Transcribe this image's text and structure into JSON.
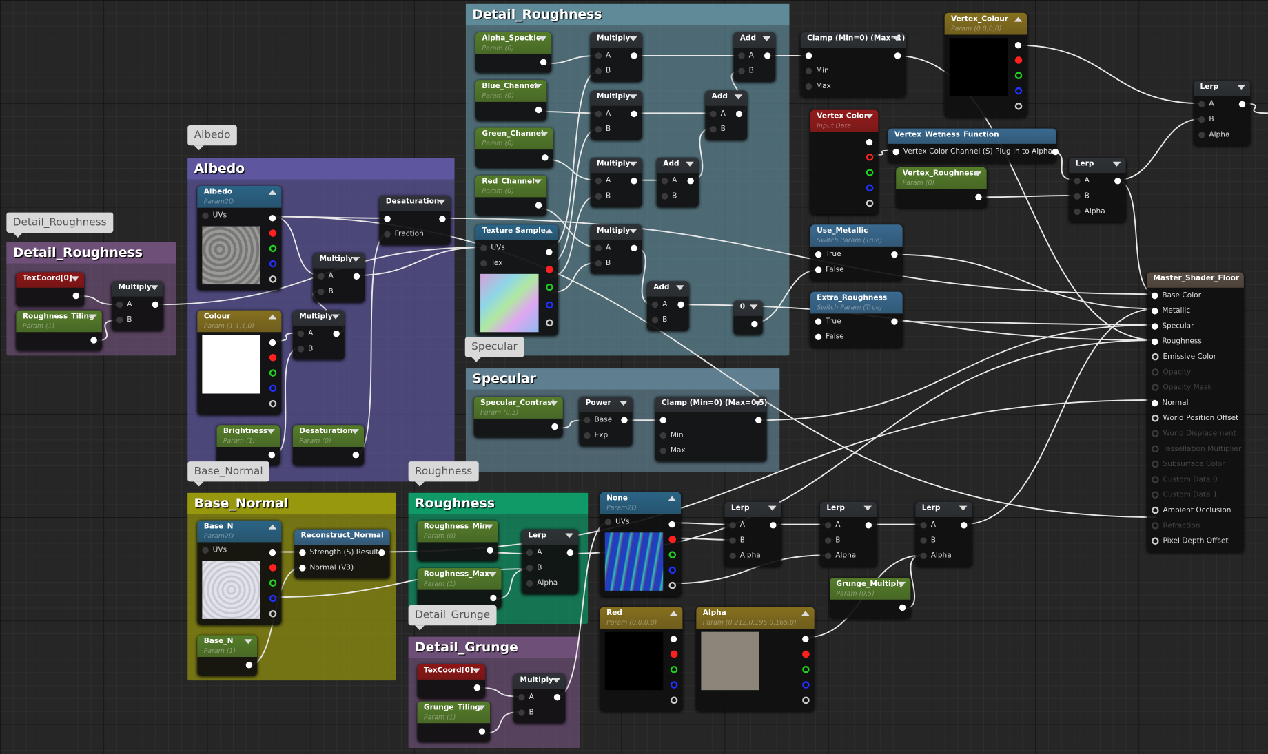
{
  "comments": [
    {
      "id": "c_detail_small",
      "title": "Detail_Roughness",
      "bubble": "Detail_Roughness",
      "color": "#6e4f77"
    },
    {
      "id": "c_albedo",
      "title": "Albedo",
      "bubble": "Albedo",
      "color": "#5e57a0"
    },
    {
      "id": "c_detail_big",
      "title": "Detail_Roughness",
      "bubble": "",
      "color": "#5f8a98"
    },
    {
      "id": "c_specular",
      "title": "Specular",
      "bubble": "Specular",
      "color": "#5f7f90"
    },
    {
      "id": "c_base_normal",
      "title": "Base_Normal",
      "bubble": "Base_Normal",
      "color": "#98980f"
    },
    {
      "id": "c_roughness",
      "title": "Roughness",
      "bubble": "Roughness",
      "color": "#0f9a68"
    },
    {
      "id": "c_detail_grunge",
      "title": "Detail_Grunge",
      "bubble": "Detail_Grunge",
      "color": "#6e4f77"
    }
  ],
  "header_colors": {
    "param": "#557d2a",
    "tex": "#2b6486",
    "vec": "#86701f",
    "coord": "#8e1616",
    "func": "#3a6a90",
    "math": "#2f3337",
    "master": "#5b4f45",
    "input": "#951b1b"
  },
  "nodes": [
    {
      "id": "texcoord1",
      "type": "coord",
      "title": "TexCoord[0]",
      "outputs": [
        ""
      ]
    },
    {
      "id": "rtiling",
      "type": "param",
      "title": "Roughness_Tiling",
      "sub": "Param (1)",
      "outputs": [
        ""
      ]
    },
    {
      "id": "mul_a",
      "type": "math",
      "title": "Multiply",
      "inputs": [
        "A",
        "B"
      ],
      "outputs": [
        ""
      ]
    },
    {
      "id": "albedo",
      "type": "tex",
      "title": "Albedo",
      "sub": "Param2D",
      "inputs": [
        "UVs"
      ],
      "preview": "#8a8a86",
      "up": true
    },
    {
      "id": "colour",
      "type": "vec",
      "title": "Colour",
      "sub": "Param (1,1,1,0)",
      "inputs": [],
      "preview": "#ffffff",
      "up": true
    },
    {
      "id": "mul_b",
      "type": "math",
      "title": "Multiply",
      "inputs": [
        "A",
        "B"
      ],
      "outputs": [
        ""
      ]
    },
    {
      "id": "mul_c",
      "type": "math",
      "title": "Multiply",
      "inputs": [
        "A",
        "B"
      ],
      "outputs": [
        ""
      ]
    },
    {
      "id": "desat1",
      "type": "math",
      "title": "Desaturation",
      "inputs": [
        "",
        "Fraction"
      ],
      "outputs": [
        ""
      ]
    },
    {
      "id": "brightness",
      "type": "param",
      "title": "Brightness",
      "sub": "Param (1)",
      "outputs": [
        ""
      ]
    },
    {
      "id": "desat_p",
      "type": "param",
      "title": "Desaturation",
      "sub": "Param (0)",
      "outputs": [
        ""
      ]
    },
    {
      "id": "alpha_speckle",
      "type": "param",
      "title": "Alpha_Speckle",
      "sub": "Param (0)",
      "outputs": [
        ""
      ]
    },
    {
      "id": "blue_ch",
      "type": "param",
      "title": "Blue_Channel",
      "sub": "Param (0)",
      "outputs": [
        ""
      ]
    },
    {
      "id": "green_ch",
      "type": "param",
      "title": "Green_Channel",
      "sub": "Param (0)",
      "outputs": [
        ""
      ]
    },
    {
      "id": "red_ch",
      "type": "param",
      "title": "Red_Channel",
      "sub": "Param (0)",
      "outputs": [
        ""
      ]
    },
    {
      "id": "texsample",
      "type": "tex",
      "title": "Texture Sample",
      "inputs": [
        "UVs",
        "Tex"
      ],
      "preview": "#9fb8d8",
      "up": true
    },
    {
      "id": "mul_d1",
      "type": "math",
      "title": "Multiply",
      "inputs": [
        "A",
        "B"
      ],
      "outputs": [
        ""
      ]
    },
    {
      "id": "mul_d2",
      "type": "math",
      "title": "Multiply",
      "inputs": [
        "A",
        "B"
      ],
      "outputs": [
        ""
      ]
    },
    {
      "id": "mul_d3",
      "type": "math",
      "title": "Multiply",
      "inputs": [
        "A",
        "B"
      ],
      "outputs": [
        ""
      ]
    },
    {
      "id": "mul_d4",
      "type": "math",
      "title": "Multiply",
      "inputs": [
        "A",
        "B"
      ],
      "outputs": [
        ""
      ]
    },
    {
      "id": "add1",
      "type": "math",
      "title": "Add",
      "inputs": [
        "A",
        "B"
      ],
      "outputs": [
        ""
      ]
    },
    {
      "id": "add2",
      "type": "math",
      "title": "Add",
      "inputs": [
        "A",
        "B"
      ],
      "outputs": [
        ""
      ]
    },
    {
      "id": "add3",
      "type": "math",
      "title": "Add",
      "inputs": [
        "A",
        "B"
      ],
      "outputs": [
        ""
      ]
    },
    {
      "id": "add4",
      "type": "math",
      "title": "Add",
      "inputs": [
        "A",
        "B"
      ],
      "outputs": [
        ""
      ]
    },
    {
      "id": "const0",
      "type": "math",
      "title": "0",
      "outputs": [
        ""
      ]
    },
    {
      "id": "clamp1",
      "type": "math",
      "title": "Clamp (Min=0) (Max=1)",
      "inputs": [
        "",
        "Min",
        "Max"
      ],
      "outputs": [
        ""
      ]
    },
    {
      "id": "vertex_colour",
      "type": "vec",
      "title": "Vertex_Colour",
      "sub": "Param (0,0,0,0)",
      "inputs": [],
      "preview": "#000000",
      "up": true
    },
    {
      "id": "vertex_color",
      "type": "input",
      "title": "Vertex Color",
      "sub": "Input Data",
      "inputs": [],
      "pinsOnly": true
    },
    {
      "id": "wetness",
      "type": "func",
      "title": "Vertex_Wetness_Function",
      "inputs": [
        "Vertex Color Channel (S)  Plug in to Alpha"
      ],
      "outputs": [
        ""
      ],
      "noarrow": true
    },
    {
      "id": "vertex_rough",
      "type": "param",
      "title": "Vertex_Roughness",
      "sub": "Param (0)",
      "outputs": [
        ""
      ]
    },
    {
      "id": "use_metallic",
      "type": "func",
      "title": "Use_Metallic",
      "sub": "Switch Param (True)",
      "inputs": [
        "True",
        "False"
      ],
      "outputs": [
        ""
      ],
      "noarrow": true
    },
    {
      "id": "extra_rough",
      "type": "func",
      "title": "Extra_Roughness",
      "sub": "Switch Param (True)",
      "inputs": [
        "True",
        "False"
      ],
      "outputs": [
        ""
      ],
      "noarrow": true
    },
    {
      "id": "lerp_top",
      "type": "math",
      "title": "Lerp",
      "inputs": [
        "A",
        "B",
        "Alpha"
      ],
      "outputs": [
        ""
      ]
    },
    {
      "id": "lerp_mid",
      "type": "math",
      "title": "Lerp",
      "inputs": [
        "A",
        "B",
        "Alpha"
      ],
      "outputs": [
        ""
      ]
    },
    {
      "id": "master",
      "type": "master",
      "title": "Master_Shader_Floor",
      "noarrow": true,
      "inputs": [
        "Base Color",
        "Metallic",
        "Specular",
        "Roughness",
        "Emissive Color",
        "Opacity",
        "Opacity Mask",
        "Normal",
        "World Position Offset",
        "World Displacement",
        "Tessellation Multiplier",
        "Subsurface Color",
        "Custom Data 0",
        "Custom Data 1",
        "Ambient Occlusion",
        "Refraction",
        "Pixel Depth Offset"
      ],
      "connected": [
        "Base Color",
        "Metallic",
        "Specular",
        "Roughness",
        "Normal"
      ],
      "disabled": [
        "Opacity",
        "Opacity Mask",
        "World Displacement",
        "Tessellation Multiplier",
        "Subsurface Color",
        "Custom Data 0",
        "Custom Data 1",
        "Refraction"
      ]
    },
    {
      "id": "spec_contrast",
      "type": "param",
      "title": "Specular_Contrast",
      "sub": "Param (0.5)",
      "outputs": [
        ""
      ]
    },
    {
      "id": "power",
      "type": "math",
      "title": "Power",
      "inputs": [
        "Base",
        "Exp"
      ],
      "outputs": [
        ""
      ]
    },
    {
      "id": "clamp2",
      "type": "math",
      "title": "Clamp (Min=0) (Max=0.5)",
      "inputs": [
        "",
        "Min",
        "Max"
      ],
      "outputs": [
        ""
      ]
    },
    {
      "id": "base_n_tex",
      "type": "tex",
      "title": "Base_N",
      "sub": "Param2D",
      "inputs": [
        "UVs"
      ],
      "preview": "#d6d6de",
      "up": true
    },
    {
      "id": "reconstruct",
      "type": "func",
      "title": "Reconstruct_Normal",
      "inputs": [
        "Strength (S) Result",
        "Normal (V3)"
      ],
      "outputs": [
        ""
      ],
      "noarrow": true
    },
    {
      "id": "base_n_p",
      "type": "param",
      "title": "Base_N",
      "sub": "Param (1)",
      "outputs": [
        ""
      ]
    },
    {
      "id": "rough_min",
      "type": "param",
      "title": "Roughness_Min",
      "sub": "Param (0)",
      "outputs": [
        ""
      ]
    },
    {
      "id": "rough_max",
      "type": "param",
      "title": "Roughness_Max",
      "sub": "Param (1)",
      "outputs": [
        ""
      ]
    },
    {
      "id": "lerp_r",
      "type": "math",
      "title": "Lerp",
      "inputs": [
        "A",
        "B",
        "Alpha"
      ],
      "outputs": [
        ""
      ]
    },
    {
      "id": "texcoord2",
      "type": "coord",
      "title": "TexCoord[0]",
      "outputs": [
        ""
      ]
    },
    {
      "id": "grunge_tiling",
      "type": "param",
      "title": "Grunge_Tiling",
      "sub": "Param (1)",
      "outputs": [
        ""
      ]
    },
    {
      "id": "mul_g",
      "type": "math",
      "title": "Multiply",
      "inputs": [
        "A",
        "B"
      ],
      "outputs": [
        ""
      ]
    },
    {
      "id": "none_tex",
      "type": "tex",
      "title": "None",
      "sub": "Param2D",
      "inputs": [
        "UVs"
      ],
      "preview": "#3a5fc0",
      "up": true
    },
    {
      "id": "red_p",
      "type": "vec",
      "title": "Red",
      "sub": "Param (0,0,0,0)",
      "inputs": [],
      "preview": "#000000",
      "up": true
    },
    {
      "id": "alpha_p",
      "type": "vec",
      "title": "Alpha",
      "sub": "Param (0.212,0.196,0.165,0)",
      "inputs": [],
      "preview": "#8c857a",
      "up": true
    },
    {
      "id": "lerp_b1",
      "type": "math",
      "title": "Lerp",
      "inputs": [
        "A",
        "B",
        "Alpha"
      ],
      "outputs": [
        ""
      ]
    },
    {
      "id": "lerp_b2",
      "type": "math",
      "title": "Lerp",
      "inputs": [
        "A",
        "B",
        "Alpha"
      ],
      "outputs": [
        ""
      ]
    },
    {
      "id": "lerp_b3",
      "type": "math",
      "title": "Lerp",
      "inputs": [
        "A",
        "B",
        "Alpha"
      ],
      "outputs": [
        ""
      ]
    },
    {
      "id": "grunge_mul",
      "type": "param",
      "title": "Grunge_Multiply",
      "sub": "Param (0.5)",
      "outputs": [
        ""
      ]
    }
  ],
  "pin_colors": [
    "#ffffff",
    "#ff2020",
    "#20d020",
    "#2030ff",
    "#cccccc"
  ]
}
